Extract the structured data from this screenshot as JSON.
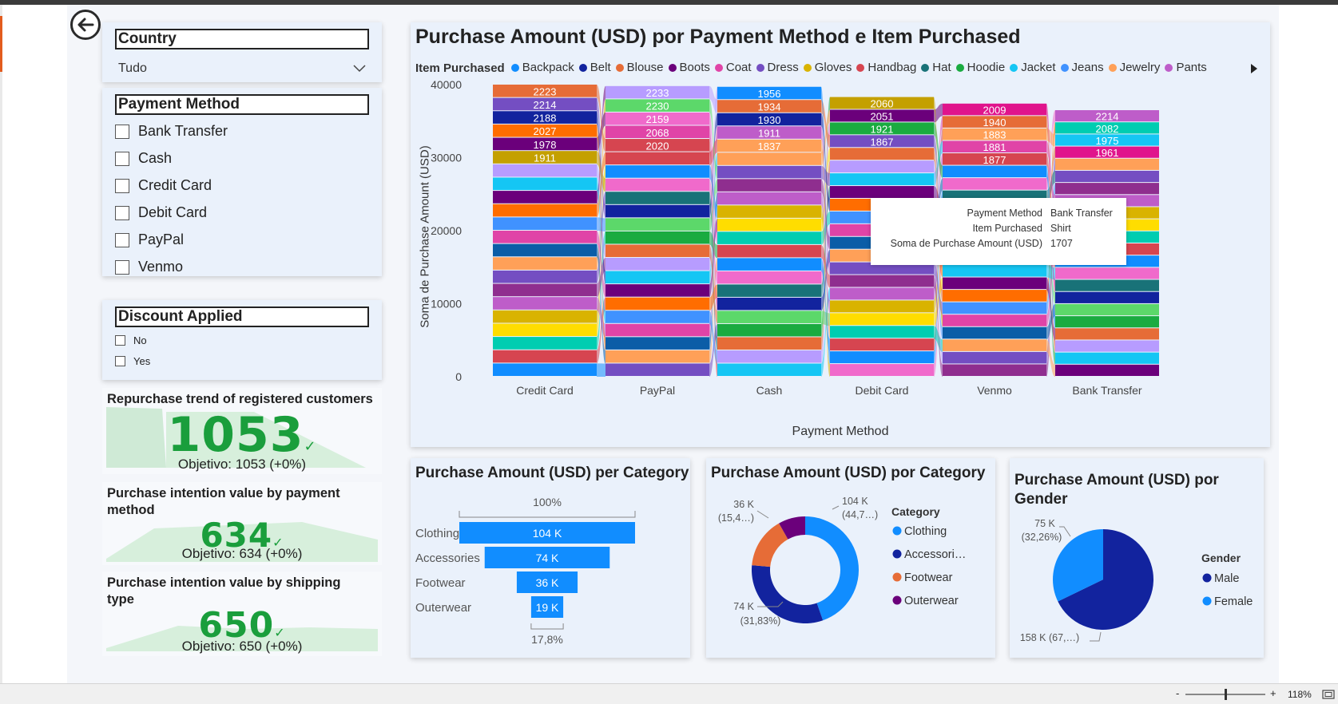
{
  "back_label": "Back",
  "filters": {
    "country": {
      "title": "Country",
      "value": "Tudo"
    },
    "payment_method": {
      "title": "Payment Method",
      "options": [
        "Bank Transfer",
        "Cash",
        "Credit Card",
        "Debit Card",
        "PayPal",
        "Venmo"
      ]
    },
    "discount": {
      "title": "Discount Applied",
      "options": [
        "No",
        "Yes"
      ]
    }
  },
  "kpis": [
    {
      "title": "Repurchase trend of registered customers",
      "value": "1053",
      "target": "Objetivo: 1053 (+0%)"
    },
    {
      "title": "Purchase intention value by payment method",
      "value": "634",
      "target": "Objetivo: 634 (+0%)"
    },
    {
      "title": "Purchase intention value by shipping type",
      "value": "650",
      "target": "Objetivo: 650 (+0%)"
    }
  ],
  "ribbon": {
    "title": "Purchase Amount (USD) por Payment Method e Item Purchased",
    "legend_title": "Item Purchased",
    "legend": [
      {
        "name": "Backpack",
        "color": "#118DFF"
      },
      {
        "name": "Belt",
        "color": "#12239E"
      },
      {
        "name": "Blouse",
        "color": "#E66C37"
      },
      {
        "name": "Boots",
        "color": "#6B007B"
      },
      {
        "name": "Coat",
        "color": "#E044A7"
      },
      {
        "name": "Dress",
        "color": "#744EC2"
      },
      {
        "name": "Gloves",
        "color": "#D9B300"
      },
      {
        "name": "Handbag",
        "color": "#D64550"
      },
      {
        "name": "Hat",
        "color": "#197278"
      },
      {
        "name": "Hoodie",
        "color": "#1AAB40"
      },
      {
        "name": "Jacket",
        "color": "#15C6F4"
      },
      {
        "name": "Jeans",
        "color": "#4092FF"
      },
      {
        "name": "Jewelry",
        "color": "#FFA058"
      },
      {
        "name": "Pants",
        "color": "#BE5DC9"
      }
    ],
    "legend_next_icon": "triangle-right-icon",
    "ylabel": "Soma de Purchase Amount (USD)",
    "xlabel": "Payment Method",
    "yticks": [
      "40000",
      "30000",
      "20000",
      "10000",
      "0"
    ],
    "tooltip": {
      "rows": [
        {
          "label": "Payment Method",
          "value": "Bank Transfer"
        },
        {
          "label": "Item Purchased",
          "value": "Shirt"
        },
        {
          "label": "Soma de Purchase Amount (USD)",
          "value": "1707"
        }
      ]
    }
  },
  "chart_data": [
    {
      "type": "bar",
      "stacked": true,
      "title": "Purchase Amount (USD) por Payment Method e Item Purchased",
      "xlabel": "Payment Method",
      "ylabel": "Soma de Purchase Amount (USD)",
      "ylim": [
        0,
        40000
      ],
      "categories": [
        "Credit Card",
        "PayPal",
        "Cash",
        "Debit Card",
        "Venmo",
        "Bank Transfer"
      ],
      "totals": [
        40000,
        39800,
        39700,
        38300,
        37400,
        36500
      ],
      "top_labels": [
        [
          "2223",
          "2214",
          "2188",
          "2027",
          "1978",
          "1911"
        ],
        [
          "2233",
          "2230",
          "2159",
          "2068",
          "2020"
        ],
        [
          "1956",
          "1934",
          "1930",
          "1911",
          "1837"
        ],
        [
          "2060",
          "2051",
          "1921",
          "1867"
        ],
        [
          "2009",
          "1940",
          "1883",
          "1881",
          "1877"
        ],
        [
          "2214",
          "2082",
          "1975",
          "1961"
        ]
      ],
      "top_colors": [
        [
          "#E66C37",
          "#744EC2",
          "#12239E",
          "#FF6D00",
          "#6B007B",
          "#C4A000"
        ],
        [
          "#B79CFF",
          "#5CD86A",
          "#F06ACB",
          "#E044A7",
          "#D64550"
        ],
        [
          "#118DFF",
          "#E66C37",
          "#12239E",
          "#BE5DC9",
          "#FFA058"
        ],
        [
          "#C4A000",
          "#6B007B",
          "#1AAB40",
          "#744EC2"
        ],
        [
          "#E0148C",
          "#E66C37",
          "#FFA058",
          "#E044A7",
          "#D64550"
        ],
        [
          "#BE5DC9",
          "#00CDB1",
          "#15C6F4",
          "#E0148C"
        ]
      ],
      "palette": [
        "#118DFF",
        "#12239E",
        "#E66C37",
        "#6B007B",
        "#E044A7",
        "#744EC2",
        "#D9B300",
        "#D64550",
        "#197278",
        "#1AAB40",
        "#15C6F4",
        "#4092FF",
        "#FFA058",
        "#BE5DC9",
        "#00CDB1",
        "#F06ACB",
        "#5CD86A",
        "#B79CFF",
        "#FF6D00",
        "#0B5DA7",
        "#8F2E8F",
        "#FFDD00"
      ]
    },
    {
      "type": "bar",
      "orientation": "funnel",
      "title": "Purchase Amount (USD) per Category",
      "categories": [
        "Clothing",
        "Accessories",
        "Footwear",
        "Outerwear"
      ],
      "values": [
        104,
        74,
        36,
        19
      ],
      "value_labels": [
        "104 K",
        "74 K",
        "36 K",
        "19 K"
      ],
      "top_label": "100%",
      "bottom_label": "17,8%",
      "color": "#118DFF"
    },
    {
      "type": "pie",
      "donut": true,
      "title": "Purchase Amount (USD) por Category",
      "legend_title": "Category",
      "categories": [
        "Clothing",
        "Accessories",
        "Footwear",
        "Outerwear"
      ],
      "legend_labels": [
        "Clothing",
        "Accessori…",
        "Footwear",
        "Outerwear"
      ],
      "values": [
        104,
        74,
        36,
        19
      ],
      "colors": [
        "#118DFF",
        "#12239E",
        "#E66C37",
        "#6B007B"
      ],
      "labels": [
        {
          "value": "104 K",
          "pct": "(44,7…)"
        },
        {
          "value": "74 K",
          "pct": "(31,83%)"
        },
        {
          "value": "36 K",
          "pct": "(15,4…)"
        }
      ]
    },
    {
      "type": "pie",
      "title": "Purchase Amount (USD) por Gender",
      "legend_title": "Gender",
      "categories": [
        "Male",
        "Female"
      ],
      "values": [
        158,
        75
      ],
      "colors": [
        "#12239E",
        "#118DFF"
      ],
      "labels": [
        {
          "value": "75 K",
          "pct": "(32,26%)"
        },
        {
          "value": "158 K",
          "pct": "(67,…)"
        }
      ]
    }
  ],
  "status": {
    "zoom": "118%",
    "minus": "-",
    "plus": "+"
  }
}
